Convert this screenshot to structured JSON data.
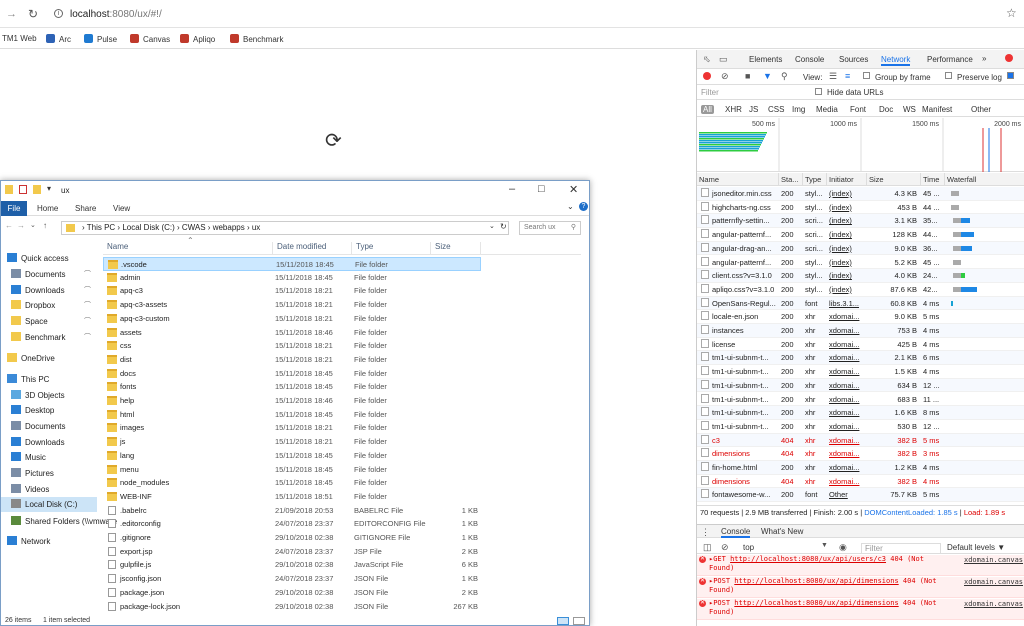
{
  "browser": {
    "url_host": "localhost",
    "url_path": ":8080/ux/#!/",
    "bookmarks": [
      {
        "label": "TM1 Web",
        "color": "#3a7bd5"
      },
      {
        "label": "Arc",
        "color": "#2d62b5"
      },
      {
        "label": "Pulse",
        "color": "#1f7ad1"
      },
      {
        "label": "Canvas",
        "color": "#c0392b"
      },
      {
        "label": "Apliqo",
        "color": "#c0392b"
      },
      {
        "label": "Benchmark",
        "color": "#c0392b"
      }
    ]
  },
  "explorer": {
    "title": "ux",
    "ribbon": {
      "file": "File",
      "home": "Home",
      "share": "Share",
      "view": "View"
    },
    "path": [
      "This PC",
      "Local Disk (C:)",
      "CWAS",
      "webapps",
      "ux"
    ],
    "search_placeholder": "Search ux",
    "columns": {
      "name": "Name",
      "date": "Date modified",
      "type": "Type",
      "size": "Size"
    },
    "nav": [
      {
        "label": "Quick access",
        "pin": false,
        "color": "#2a7fd4"
      },
      {
        "label": "Documents",
        "pin": true,
        "color": "#7b8da6"
      },
      {
        "label": "Downloads",
        "pin": true,
        "color": "#2a7fd4"
      },
      {
        "label": "Dropbox",
        "pin": true,
        "color": "#f2c94c"
      },
      {
        "label": "Space",
        "pin": true,
        "color": "#f2c94c"
      },
      {
        "label": "Benchmark",
        "pin": true,
        "color": "#f2c94c"
      },
      {
        "label": "OneDrive",
        "pin": false,
        "color": "#f2c94c"
      },
      {
        "label": "This PC",
        "pin": false,
        "color": "#3b8ad8"
      },
      {
        "label": "3D Objects",
        "pin": false,
        "color": "#5aa8e0"
      },
      {
        "label": "Desktop",
        "pin": false,
        "color": "#2a7fd4"
      },
      {
        "label": "Documents",
        "pin": false,
        "color": "#7b8da6"
      },
      {
        "label": "Downloads",
        "pin": false,
        "color": "#2a7fd4"
      },
      {
        "label": "Music",
        "pin": false,
        "color": "#2a7fd4"
      },
      {
        "label": "Pictures",
        "pin": false,
        "color": "#7b8da6"
      },
      {
        "label": "Videos",
        "pin": false,
        "color": "#7b8da6"
      },
      {
        "label": "Local Disk (C:)",
        "pin": false,
        "color": "#888888"
      },
      {
        "label": "Shared Folders (\\\\vmware",
        "pin": false,
        "color": "#5a8a3c"
      },
      {
        "label": "Network",
        "pin": false,
        "color": "#2a7fd4"
      }
    ],
    "files": [
      {
        "name": ".vscode",
        "date": "15/11/2018 18:45",
        "type": "File folder",
        "size": "",
        "kind": "folder"
      },
      {
        "name": "admin",
        "date": "15/11/2018 18:45",
        "type": "File folder",
        "size": "",
        "kind": "folder"
      },
      {
        "name": "apq-c3",
        "date": "15/11/2018 18:21",
        "type": "File folder",
        "size": "",
        "kind": "folder"
      },
      {
        "name": "apq-c3-assets",
        "date": "15/11/2018 18:21",
        "type": "File folder",
        "size": "",
        "kind": "folder"
      },
      {
        "name": "apq-c3-custom",
        "date": "15/11/2018 18:21",
        "type": "File folder",
        "size": "",
        "kind": "folder"
      },
      {
        "name": "assets",
        "date": "15/11/2018 18:46",
        "type": "File folder",
        "size": "",
        "kind": "folder"
      },
      {
        "name": "css",
        "date": "15/11/2018 18:21",
        "type": "File folder",
        "size": "",
        "kind": "folder"
      },
      {
        "name": "dist",
        "date": "15/11/2018 18:21",
        "type": "File folder",
        "size": "",
        "kind": "folder"
      },
      {
        "name": "docs",
        "date": "15/11/2018 18:45",
        "type": "File folder",
        "size": "",
        "kind": "folder"
      },
      {
        "name": "fonts",
        "date": "15/11/2018 18:45",
        "type": "File folder",
        "size": "",
        "kind": "folder"
      },
      {
        "name": "help",
        "date": "15/11/2018 18:46",
        "type": "File folder",
        "size": "",
        "kind": "folder"
      },
      {
        "name": "html",
        "date": "15/11/2018 18:45",
        "type": "File folder",
        "size": "",
        "kind": "folder"
      },
      {
        "name": "images",
        "date": "15/11/2018 18:21",
        "type": "File folder",
        "size": "",
        "kind": "folder"
      },
      {
        "name": "js",
        "date": "15/11/2018 18:21",
        "type": "File folder",
        "size": "",
        "kind": "folder"
      },
      {
        "name": "lang",
        "date": "15/11/2018 18:45",
        "type": "File folder",
        "size": "",
        "kind": "folder"
      },
      {
        "name": "menu",
        "date": "15/11/2018 18:45",
        "type": "File folder",
        "size": "",
        "kind": "folder"
      },
      {
        "name": "node_modules",
        "date": "15/11/2018 18:45",
        "type": "File folder",
        "size": "",
        "kind": "folder"
      },
      {
        "name": "WEB-INF",
        "date": "15/11/2018 18:51",
        "type": "File folder",
        "size": "",
        "kind": "folder"
      },
      {
        "name": ".babelrc",
        "date": "21/09/2018 20:53",
        "type": "BABELRC File",
        "size": "1 KB",
        "kind": "file"
      },
      {
        "name": ".editorconfig",
        "date": "24/07/2018 23:37",
        "type": "EDITORCONFIG File",
        "size": "1 KB",
        "kind": "file"
      },
      {
        "name": ".gitignore",
        "date": "29/10/2018 02:38",
        "type": "GITIGNORE File",
        "size": "1 KB",
        "kind": "file"
      },
      {
        "name": "export.jsp",
        "date": "24/07/2018 23:37",
        "type": "JSP File",
        "size": "2 KB",
        "kind": "file"
      },
      {
        "name": "gulpfile.js",
        "date": "29/10/2018 02:38",
        "type": "JavaScript File",
        "size": "6 KB",
        "kind": "file"
      },
      {
        "name": "jsconfig.json",
        "date": "24/07/2018 23:37",
        "type": "JSON File",
        "size": "1 KB",
        "kind": "file"
      },
      {
        "name": "package.json",
        "date": "29/10/2018 02:38",
        "type": "JSON File",
        "size": "2 KB",
        "kind": "file"
      },
      {
        "name": "package-lock.json",
        "date": "29/10/2018 02:38",
        "type": "JSON File",
        "size": "267 KB",
        "kind": "file"
      }
    ],
    "status_count": "26 items",
    "status_selected": "1 item selected"
  },
  "devtools": {
    "tabs": [
      "Elements",
      "Console",
      "Sources",
      "Network",
      "Performance"
    ],
    "active_tab": "Network",
    "more": "»",
    "view_label": "View:",
    "group_by_frame": "Group by frame",
    "preserve_log": "Preserve log",
    "filter_placeholder": "Filter",
    "hide_data_urls": "Hide data URLs",
    "filter_types": [
      "All",
      "XHR",
      "JS",
      "CSS",
      "Img",
      "Media",
      "Font",
      "Doc",
      "WS",
      "Manifest",
      "Other"
    ],
    "ticks": [
      "500 ms",
      "1000 ms",
      "1500 ms",
      "2000 ms"
    ],
    "columns": {
      "name": "Name",
      "status": "Sta...",
      "type": "Type",
      "initiator": "Initiator",
      "size": "Size",
      "time": "Time",
      "waterfall": "Waterfall"
    },
    "requests": [
      {
        "name": "jsoneditor.min.css",
        "status": "200",
        "type": "styl...",
        "initiator": "(index)",
        "size": "4.3 KB",
        "time": "45 ...",
        "err": false,
        "wf_start": 0.03,
        "wf_len": 0.02,
        "wf_color": "#17a2d4"
      },
      {
        "name": "highcharts-ng.css",
        "status": "200",
        "type": "styl...",
        "initiator": "(index)",
        "size": "453 B",
        "time": "44 ...",
        "err": false,
        "wf_start": 0.03,
        "wf_len": 0.02,
        "wf_color": "#17a2d4"
      },
      {
        "name": "patternfly-settin...",
        "status": "200",
        "type": "scri...",
        "initiator": "(index)",
        "size": "3.1 KB",
        "time": "35...",
        "err": false,
        "wf_start": 0.05,
        "wf_len": 0.25,
        "wf_color": "#1e88e5"
      },
      {
        "name": "angular-patternf...",
        "status": "200",
        "type": "scri...",
        "initiator": "(index)",
        "size": "128 KB",
        "time": "44...",
        "err": false,
        "wf_start": 0.05,
        "wf_len": 0.3,
        "wf_color": "#1e88e5"
      },
      {
        "name": "angular-drag-an...",
        "status": "200",
        "type": "scri...",
        "initiator": "(index)",
        "size": "9.0 KB",
        "time": "36...",
        "err": false,
        "wf_start": 0.05,
        "wf_len": 0.28,
        "wf_color": "#1e88e5"
      },
      {
        "name": "angular-patternf...",
        "status": "200",
        "type": "styl...",
        "initiator": "(index)",
        "size": "5.2 KB",
        "time": "45 ...",
        "err": false,
        "wf_start": 0.05,
        "wf_len": 0.03,
        "wf_color": "#17a2d4"
      },
      {
        "name": "client.css?v=3.1.0",
        "status": "200",
        "type": "styl...",
        "initiator": "(index)",
        "size": "4.0 KB",
        "time": "24...",
        "err": false,
        "wf_start": 0.05,
        "wf_len": 0.18,
        "wf_color": "#2ecc40"
      },
      {
        "name": "apliqo.css?v=3.1.0",
        "status": "200",
        "type": "styl...",
        "initiator": "(index)",
        "size": "87.6 KB",
        "time": "42...",
        "err": false,
        "wf_start": 0.05,
        "wf_len": 0.35,
        "wf_color": "#1e88e5"
      },
      {
        "name": "OpenSans-Regul...",
        "status": "200",
        "type": "font",
        "initiator": "libs.3.1...",
        "size": "60.8 KB",
        "time": "4 ms",
        "err": false,
        "wf_start": 0,
        "wf_len": 0,
        "wf_color": ""
      },
      {
        "name": "locale-en.json",
        "status": "200",
        "type": "xhr",
        "initiator": "xdomai...",
        "size": "9.0 KB",
        "time": "5 ms",
        "err": false,
        "wf_start": 0,
        "wf_len": 0,
        "wf_color": ""
      },
      {
        "name": "instances",
        "status": "200",
        "type": "xhr",
        "initiator": "xdomai...",
        "size": "753 B",
        "time": "4 ms",
        "err": false,
        "wf_start": 0,
        "wf_len": 0,
        "wf_color": ""
      },
      {
        "name": "license",
        "status": "200",
        "type": "xhr",
        "initiator": "xdomai...",
        "size": "425 B",
        "time": "4 ms",
        "err": false,
        "wf_start": 0,
        "wf_len": 0,
        "wf_color": ""
      },
      {
        "name": "tm1-ui-subnm-t...",
        "status": "200",
        "type": "xhr",
        "initiator": "xdomai...",
        "size": "2.1 KB",
        "time": "6 ms",
        "err": false,
        "wf_start": 0,
        "wf_len": 0,
        "wf_color": ""
      },
      {
        "name": "tm1-ui-subnm-t...",
        "status": "200",
        "type": "xhr",
        "initiator": "xdomai...",
        "size": "1.5 KB",
        "time": "4 ms",
        "err": false,
        "wf_start": 0,
        "wf_len": 0,
        "wf_color": ""
      },
      {
        "name": "tm1-ui-subnm-t...",
        "status": "200",
        "type": "xhr",
        "initiator": "xdomai...",
        "size": "634 B",
        "time": "12 ...",
        "err": false,
        "wf_start": 0,
        "wf_len": 0,
        "wf_color": ""
      },
      {
        "name": "tm1-ui-subnm-t...",
        "status": "200",
        "type": "xhr",
        "initiator": "xdomai...",
        "size": "683 B",
        "time": "11 ...",
        "err": false,
        "wf_start": 0,
        "wf_len": 0,
        "wf_color": ""
      },
      {
        "name": "tm1-ui-subnm-t...",
        "status": "200",
        "type": "xhr",
        "initiator": "xdomai...",
        "size": "1.6 KB",
        "time": "8 ms",
        "err": false,
        "wf_start": 0,
        "wf_len": 0,
        "wf_color": ""
      },
      {
        "name": "tm1-ui-subnm-t...",
        "status": "200",
        "type": "xhr",
        "initiator": "xdomai...",
        "size": "530 B",
        "time": "12 ...",
        "err": false,
        "wf_start": 0,
        "wf_len": 0,
        "wf_color": ""
      },
      {
        "name": "c3",
        "status": "404",
        "type": "xhr",
        "initiator": "xdomai...",
        "size": "382 B",
        "time": "5 ms",
        "err": true,
        "wf_start": 0,
        "wf_len": 0,
        "wf_color": ""
      },
      {
        "name": "dimensions",
        "status": "404",
        "type": "xhr",
        "initiator": "xdomai...",
        "size": "382 B",
        "time": "3 ms",
        "err": true,
        "wf_start": 0,
        "wf_len": 0,
        "wf_color": ""
      },
      {
        "name": "fin-home.html",
        "status": "200",
        "type": "xhr",
        "initiator": "xdomai...",
        "size": "1.2 KB",
        "time": "4 ms",
        "err": false,
        "wf_start": 0,
        "wf_len": 0,
        "wf_color": ""
      },
      {
        "name": "dimensions",
        "status": "404",
        "type": "xhr",
        "initiator": "xdomai...",
        "size": "382 B",
        "time": "4 ms",
        "err": true,
        "wf_start": 0,
        "wf_len": 0,
        "wf_color": ""
      },
      {
        "name": "fontawesome-w...",
        "status": "200",
        "type": "font",
        "initiator": "Other",
        "size": "75.7 KB",
        "time": "5 ms",
        "err": false,
        "wf_start": 0,
        "wf_len": 0,
        "wf_color": ""
      }
    ],
    "summary": {
      "text": "70 requests | 2.9 MB transferred | Finish: 2.00 s |",
      "dcl": "DOMContentLoaded: 1.85 s",
      "sep": "|",
      "load": "Load: 1.89 s"
    },
    "console_tabs": [
      "Console",
      "What's New"
    ],
    "console_context": "top",
    "console_filter_placeholder": "Filter",
    "default_levels": "Default levels ▼",
    "console_messages": [
      {
        "method": "▸GET",
        "url": "http://localhost:8080/ux/api/users/c3",
        "status": "404 (Not",
        "status2": "Found)",
        "source": "xdomain.canvas"
      },
      {
        "method": "▸POST",
        "url": "http://localhost:8080/ux/api/dimensions",
        "status": "404 (Not",
        "status2": "Found)",
        "source": "xdomain.canvas"
      },
      {
        "method": "▸POST",
        "url": "http://localhost:8080/ux/api/dimensions",
        "status": "404 (Not",
        "status2": "Found)",
        "source": "xdomain.canvas"
      }
    ]
  }
}
